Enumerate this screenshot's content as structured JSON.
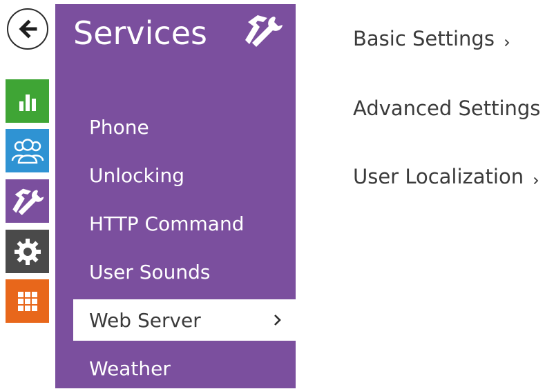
{
  "panel": {
    "title": "Services",
    "icon": "tools-icon",
    "menu": [
      {
        "label": "Phone",
        "active": false
      },
      {
        "label": "Unlocking",
        "active": false
      },
      {
        "label": "HTTP Command",
        "active": false
      },
      {
        "label": "User Sounds",
        "active": false
      },
      {
        "label": "Web Server",
        "active": true
      },
      {
        "label": "Weather",
        "active": false
      }
    ]
  },
  "nav": {
    "back": "back-arrow-icon",
    "items": [
      {
        "icon": "bar-chart-icon",
        "color": "#3fa535"
      },
      {
        "icon": "users-icon",
        "color": "#2f93d3"
      },
      {
        "icon": "tools-icon",
        "color": "#7b4f9e"
      },
      {
        "icon": "gear-icon",
        "color": "#4a4a4a"
      },
      {
        "icon": "grid-icon",
        "color": "#e8671b"
      }
    ]
  },
  "content": {
    "links": [
      {
        "label": "Basic Settings"
      },
      {
        "label": "Advanced Settings"
      },
      {
        "label": "User Localization"
      }
    ]
  },
  "colors": {
    "accent": "#7b4f9e",
    "active_item_bg": "#ffffff",
    "text": "#3b3b3b"
  }
}
